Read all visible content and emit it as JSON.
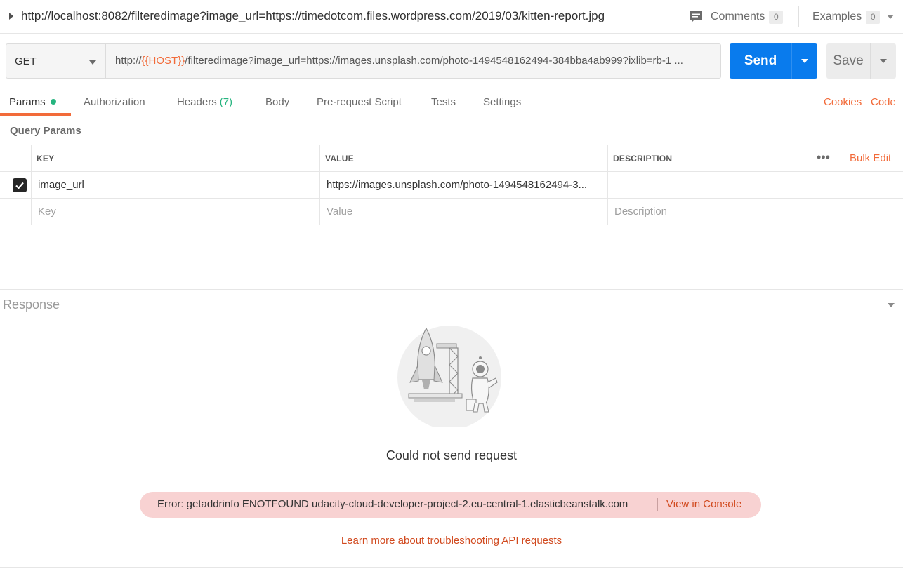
{
  "title_bar": {
    "request_url": "http://localhost:8082/filteredimage?image_url=https://timedotcom.files.wordpress.com/2019/03/kitten-report.jpg",
    "comments_label": "Comments",
    "comments_count": "0",
    "examples_label": "Examples",
    "examples_count": "0"
  },
  "url_bar": {
    "method": "GET",
    "url_prefix": "http://",
    "url_variable": "{{HOST}}",
    "url_rest": "/filteredimage?image_url=https://images.unsplash.com/photo-1494548162494-384bba4ab999?ixlib=rb-1 ...",
    "send_label": "Send",
    "save_label": "Save"
  },
  "tabs": [
    {
      "label": "Params"
    },
    {
      "label": "Authorization"
    },
    {
      "label": "Headers",
      "count": "(7)"
    },
    {
      "label": "Body"
    },
    {
      "label": "Pre-request Script"
    },
    {
      "label": "Tests"
    },
    {
      "label": "Settings"
    }
  ],
  "tab_links": {
    "cookies": "Cookies",
    "code": "Code"
  },
  "query_params": {
    "section_label": "Query Params",
    "headers": {
      "key": "KEY",
      "value": "VALUE",
      "description": "DESCRIPTION"
    },
    "bulk_edit": "Bulk Edit",
    "more": "•••",
    "rows": [
      {
        "checked": true,
        "key": "image_url",
        "value": "https://images.unsplash.com/photo-1494548162494-3...",
        "description": ""
      }
    ],
    "placeholders": {
      "key": "Key",
      "value": "Value",
      "description": "Description"
    }
  },
  "response": {
    "title": "Response",
    "message": "Could not send request",
    "error": "Error: getaddrinfo ENOTFOUND udacity-cloud-developer-project-2.eu-central-1.elasticbeanstalk.com",
    "view_console": "View in Console",
    "learn_more": "Learn more about troubleshooting API requests"
  },
  "colors": {
    "accent_orange": "#f26b3a",
    "send_blue": "#097bed",
    "status_green": "#26b47f",
    "error_bg": "#f8d2d2"
  }
}
